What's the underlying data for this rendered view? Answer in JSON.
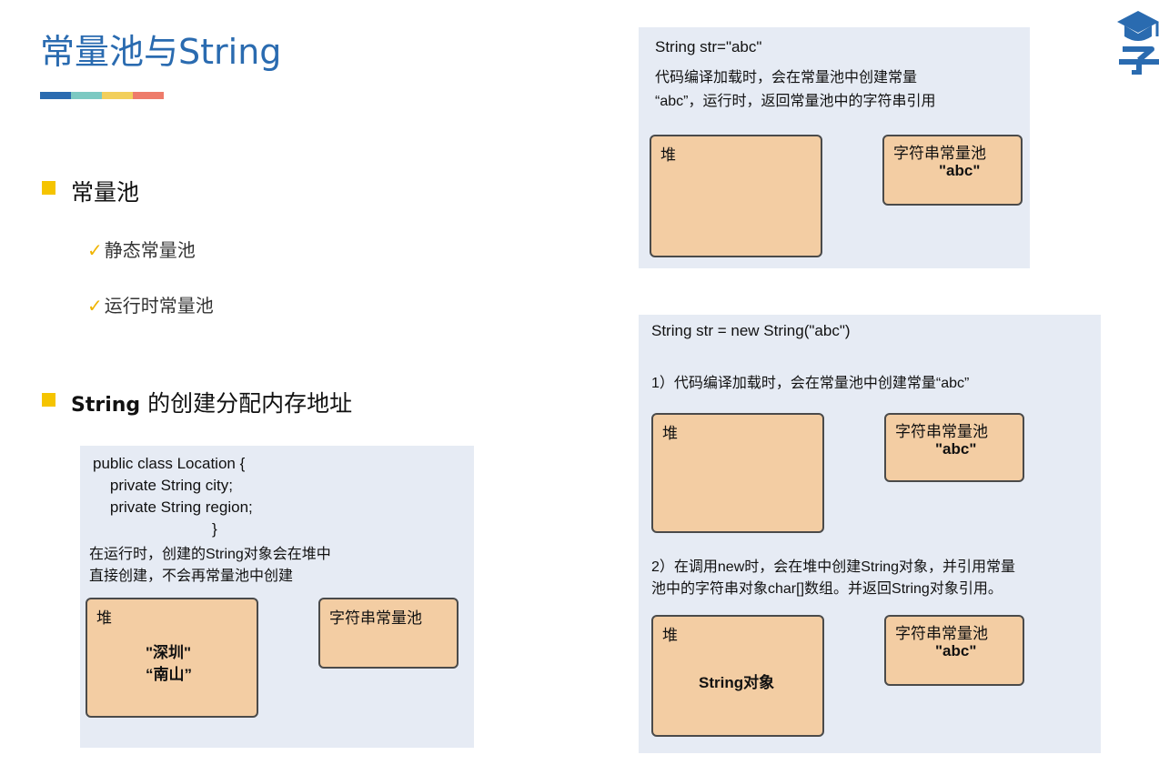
{
  "title": "常量池与String",
  "color_bar": [
    "#2a6bb0",
    "#7cc9c2",
    "#f2cf5b",
    "#ee7b6a"
  ],
  "logo": {
    "icon": "graduation-cap-icon",
    "char": "子",
    "color": "#2a6bb0"
  },
  "section1": {
    "heading": "常量池",
    "items": [
      "静态常量池",
      "运行时常量池"
    ]
  },
  "section2": {
    "heading_bold": "String",
    "heading_rest": " 的创建分配内存地址"
  },
  "panel_left": {
    "code": [
      "public class Location {",
      "    private String city;",
      "    private String region;",
      "}"
    ],
    "desc": [
      "在运行时，创建的String对象会在堆中",
      "直接创建，不会再常量池中创建"
    ],
    "heap_label": "堆",
    "heap_values": [
      "\"深圳\"",
      "“南山”"
    ],
    "pool_label": "字符串常量池"
  },
  "panel_top_right": {
    "code": "String str=\"abc\"",
    "desc": [
      "代码编译加载时，会在常量池中创建常量",
      "“abc”，运行时，返回常量池中的字符串引用"
    ],
    "heap_label": "堆",
    "pool_label": "字符串常量池",
    "pool_value": "\"abc\""
  },
  "panel_bottom_right": {
    "code": "String str = new String(\"abc\")",
    "step1": "1）代码编译加载时，会在常量池中创建常量“abc”",
    "heap1_label": "堆",
    "pool1_label": "字符串常量池",
    "pool1_value": "\"abc\"",
    "step2": [
      "2）在调用new时，会在堆中创建String对象，并引用常量",
      "池中的字符串对象char[]数组。并返回String对象引用。"
    ],
    "heap2_label": "堆",
    "heap2_value": "String对象",
    "pool2_label": "字符串常量池",
    "pool2_value": "\"abc\""
  }
}
